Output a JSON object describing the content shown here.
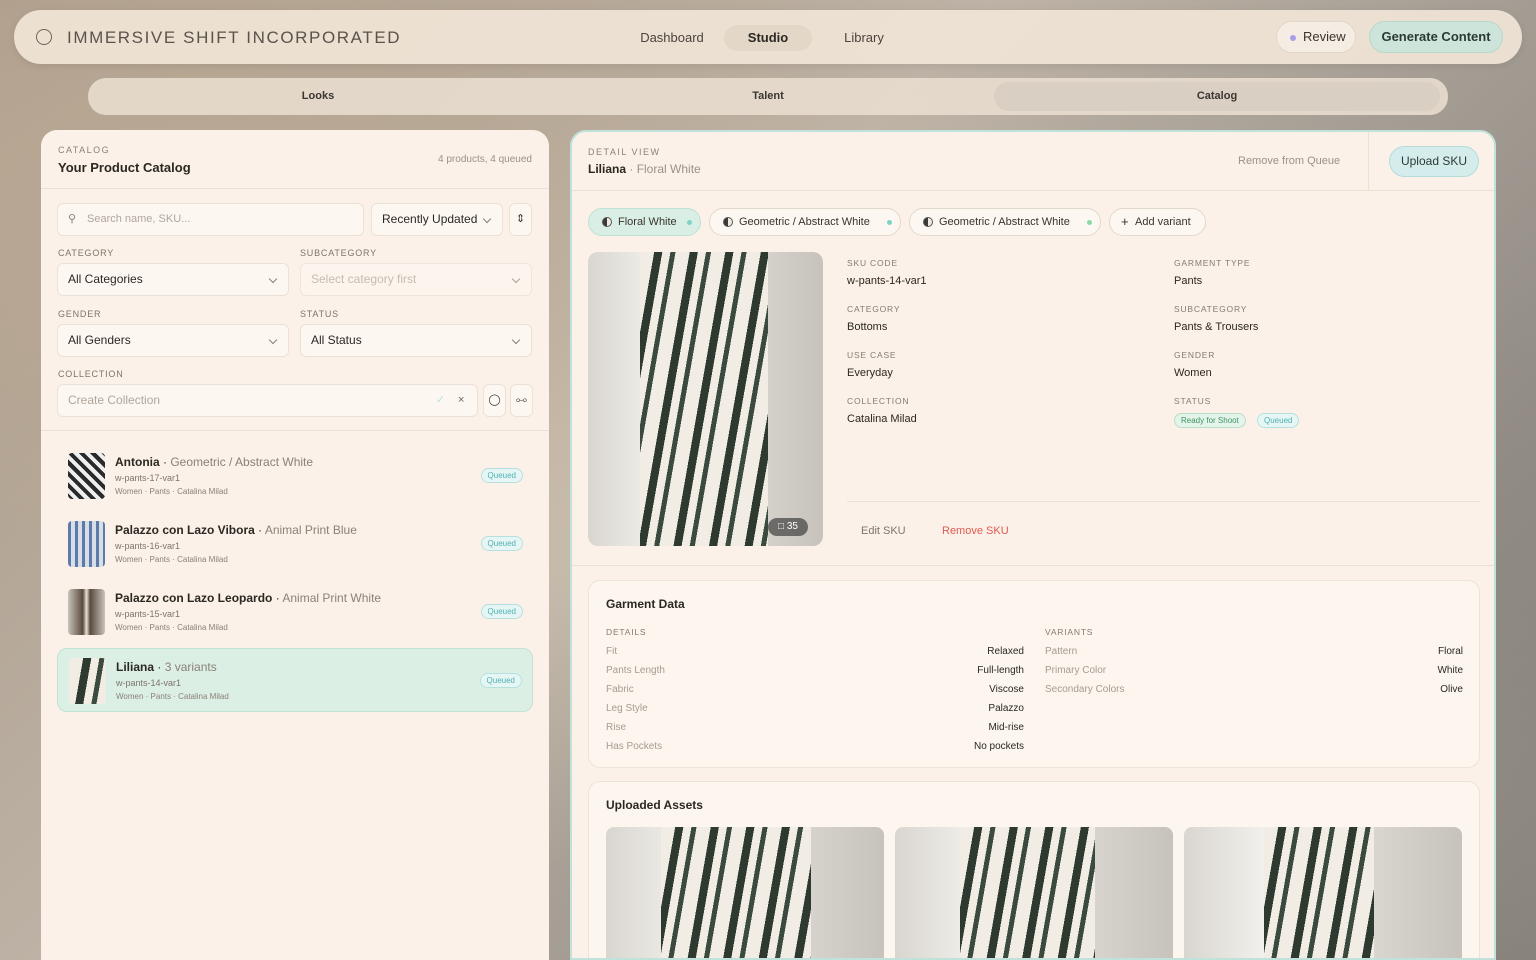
{
  "brand": "IMMERSIVE SHIFT INCORPORATED",
  "nav": {
    "tabs": [
      "Dashboard",
      "Studio",
      "Library"
    ],
    "active": "Studio",
    "review": "Review",
    "generate": "Generate Content"
  },
  "subtabs": {
    "items": [
      "Looks",
      "Talent",
      "Catalog"
    ],
    "active": "Catalog"
  },
  "catalog": {
    "eyebrow": "CATALOG",
    "title": "Your Product Catalog",
    "count": "4 products, 4 queued",
    "search_placeholder": "Search name, SKU...",
    "sort": "Recently Updated",
    "category_label": "CATEGORY",
    "category": "All Categories",
    "subcategory_label": "SUBCATEGORY",
    "subcategory_placeholder": "Select category first",
    "gender_label": "GENDER",
    "gender": "All Genders",
    "status_label": "STATUS",
    "status": "All Status",
    "collection_label": "COLLECTION",
    "collection_placeholder": "Create Collection",
    "items": [
      {
        "name": "Antonia",
        "sub": "Geometric / Abstract White",
        "sku": "w-pants-17-var1",
        "meta": "Women · Pants · Catalina Milad",
        "badge": "Queued"
      },
      {
        "name": "Palazzo con Lazo Vibora",
        "sub": "Animal Print Blue",
        "sku": "w-pants-16-var1",
        "meta": "Women · Pants · Catalina Milad",
        "badge": "Queued"
      },
      {
        "name": "Palazzo con Lazo Leopardo",
        "sub": "Animal Print White",
        "sku": "w-pants-15-var1",
        "meta": "Women · Pants · Catalina Milad",
        "badge": "Queued"
      },
      {
        "name": "Liliana",
        "sub": "3 variants",
        "sku": "w-pants-14-var1",
        "meta": "Women · Pants · Catalina Milad",
        "badge": "Queued"
      }
    ]
  },
  "detail": {
    "eyebrow": "DETAIL VIEW",
    "name": "Liliana",
    "variant": "Floral White",
    "remove_queue": "Remove from Queue",
    "upload": "Upload SKU",
    "chips": [
      "Floral White",
      "Geometric / Abstract White",
      "Geometric / Abstract White"
    ],
    "add_variant": "Add variant",
    "image_count": "35",
    "fields": {
      "sku_label": "SKU CODE",
      "sku": "w-pants-14-var1",
      "garment_label": "GARMENT TYPE",
      "garment": "Pants",
      "category_label": "CATEGORY",
      "category": "Bottoms",
      "subcategory_label": "SUBCATEGORY",
      "subcategory": "Pants & Trousers",
      "usecase_label": "USE CASE",
      "usecase": "Everyday",
      "gender_label": "GENDER",
      "gender": "Women",
      "collection_label": "COLLECTION",
      "collection": "Catalina Milad",
      "status_label": "STATUS",
      "status1": "Ready for Shoot",
      "status2": "Queued"
    },
    "edit": "Edit SKU",
    "remove": "Remove SKU",
    "garment_data": {
      "title": "Garment Data",
      "details_label": "DETAILS",
      "variants_label": "VARIANTS",
      "details": [
        [
          "Fit",
          "Relaxed"
        ],
        [
          "Pants Length",
          "Full-length"
        ],
        [
          "Fabric",
          "Viscose"
        ],
        [
          "Leg Style",
          "Palazzo"
        ],
        [
          "Rise",
          "Mid-rise"
        ],
        [
          "Has Pockets",
          "No pockets"
        ]
      ],
      "variants": [
        [
          "Pattern",
          "Floral"
        ],
        [
          "Primary Color",
          "White"
        ],
        [
          "Secondary Colors",
          "Olive"
        ]
      ]
    },
    "assets_title": "Uploaded Assets"
  },
  "colors": {
    "accent": "#cde4da",
    "queued": "#4fb1b1",
    "ready": "#3d9462",
    "danger": "#e05a4f"
  }
}
